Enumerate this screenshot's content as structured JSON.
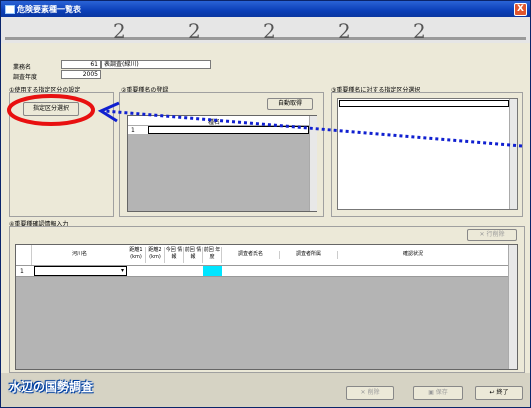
{
  "window": {
    "title": "危険要素種一覧表",
    "close": "X"
  },
  "info": {
    "business_label": "業務名",
    "business_no": "61",
    "business_name": "表調査(緑川)",
    "year_label": "調査年度",
    "year_value": "2005"
  },
  "sections": {
    "designated": "①使用する指定区分の設定",
    "register": "②重要種名の登録",
    "target": "③重要種名に対する指定区分選択",
    "confirm": "④重要種確認情報入力"
  },
  "buttons": {
    "select_designated": "指定区分選択",
    "auto_fetch": "自動取得",
    "row_delete": "行削除",
    "delete": "削除",
    "save": "保存",
    "exit": "終了"
  },
  "species_table": {
    "header": "種名",
    "row_no": "1"
  },
  "confirm_table": {
    "columns": [
      "河川名",
      "距離1 (km)",
      "距離2 (km)",
      "今回 情報",
      "前回 情報",
      "前回 年度",
      "調査者氏名",
      "調査者所属",
      "確認状況"
    ],
    "row_no": "1"
  },
  "footer": {
    "logo": "水辺の国勢調査"
  },
  "colors": {
    "highlight_circle": "#e81010",
    "arrow": "#1020d0",
    "cyan_cell": "#00e5ff"
  }
}
